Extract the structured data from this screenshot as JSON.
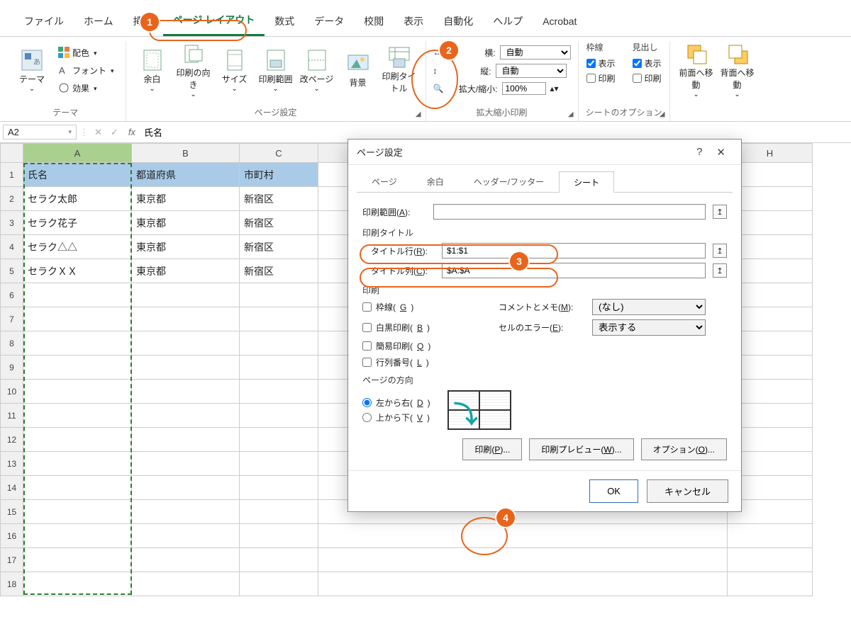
{
  "tabs": [
    "ファイル",
    "ホーム",
    "挿入",
    "ページ レイアウト",
    "数式",
    "データ",
    "校閲",
    "表示",
    "自動化",
    "ヘルプ",
    "Acrobat"
  ],
  "active_tab_index": 3,
  "ribbon": {
    "themes": {
      "label": "テーマ",
      "theme": "テーマ",
      "colors": "配色",
      "fonts": "フォント",
      "effects": "効果"
    },
    "pageSetup": {
      "label": "ページ設定",
      "margins": "余白",
      "orientation": "印刷の向き",
      "size": "サイズ",
      "printArea": "印刷範囲",
      "breaks": "改ページ",
      "background": "背景",
      "printTitles": "印刷タイトル"
    },
    "scale": {
      "label": "拡大縮小印刷",
      "width": "横:",
      "height": "縦:",
      "auto": "自動",
      "scale": "拡大/縮小:",
      "scale_val": "100%"
    },
    "sheetOpts": {
      "label": "シートのオプション",
      "gridlines": "枠線",
      "headings": "見出し",
      "view": "表示",
      "print": "印刷",
      "grid_view": true,
      "grid_print": false,
      "head_view": true,
      "head_print": false
    },
    "arrange": {
      "front": "前面へ移動",
      "back": "背面へ移動"
    }
  },
  "formula_bar": {
    "namebox": "A2",
    "fx": "fx",
    "value": "氏名"
  },
  "columns": [
    "A",
    "B",
    "C",
    "H"
  ],
  "headers": [
    "氏名",
    "都道府県",
    "市町村"
  ],
  "rows": [
    {
      "n": 1,
      "a": "氏名",
      "b": "都道府県",
      "c": "市町村"
    },
    {
      "n": 2,
      "a": "セラク太郎",
      "b": "東京都",
      "c": "新宿区"
    },
    {
      "n": 3,
      "a": "セラク花子",
      "b": "東京都",
      "c": "新宿区"
    },
    {
      "n": 4,
      "a": "セラク△△",
      "b": "東京都",
      "c": "新宿区"
    },
    {
      "n": 5,
      "a": "セラクＸＸ",
      "b": "東京都",
      "c": "新宿区"
    }
  ],
  "empty_rows": [
    6,
    7,
    8,
    9,
    10,
    11,
    12,
    13,
    14,
    15,
    16,
    17,
    18
  ],
  "dialog": {
    "title": "ページ設定",
    "tabs": [
      "ページ",
      "余白",
      "ヘッダー/フッター",
      "シート"
    ],
    "active_tab": 3,
    "printArea": {
      "label": "印刷範囲(A):",
      "value": ""
    },
    "printTitles": {
      "label": "印刷タイトル",
      "rows_label": "タイトル行(R):",
      "rows_value": "$1:$1",
      "cols_label": "タイトル列(C):",
      "cols_value": "$A:$A"
    },
    "printSection": {
      "label": "印刷",
      "gridlines": "枠線(G)",
      "bw": "白黒印刷(B)",
      "draft": "簡易印刷(Q)",
      "rowcol": "行列番号(L)",
      "comments_label": "コメントとメモ(M):",
      "comments_val": "(なし)",
      "errors_label": "セルのエラー(E):",
      "errors_val": "表示する"
    },
    "pageOrder": {
      "label": "ページの方向",
      "ltr": "左から右(D)",
      "ttb": "上から下(V)"
    },
    "buttons": {
      "print": "印刷(P)...",
      "preview": "印刷プレビュー(W)...",
      "options": "オプション(O)...",
      "ok": "OK",
      "cancel": "キャンセル"
    }
  },
  "callouts": {
    "1": "1",
    "2": "2",
    "3": "3",
    "4": "4"
  }
}
